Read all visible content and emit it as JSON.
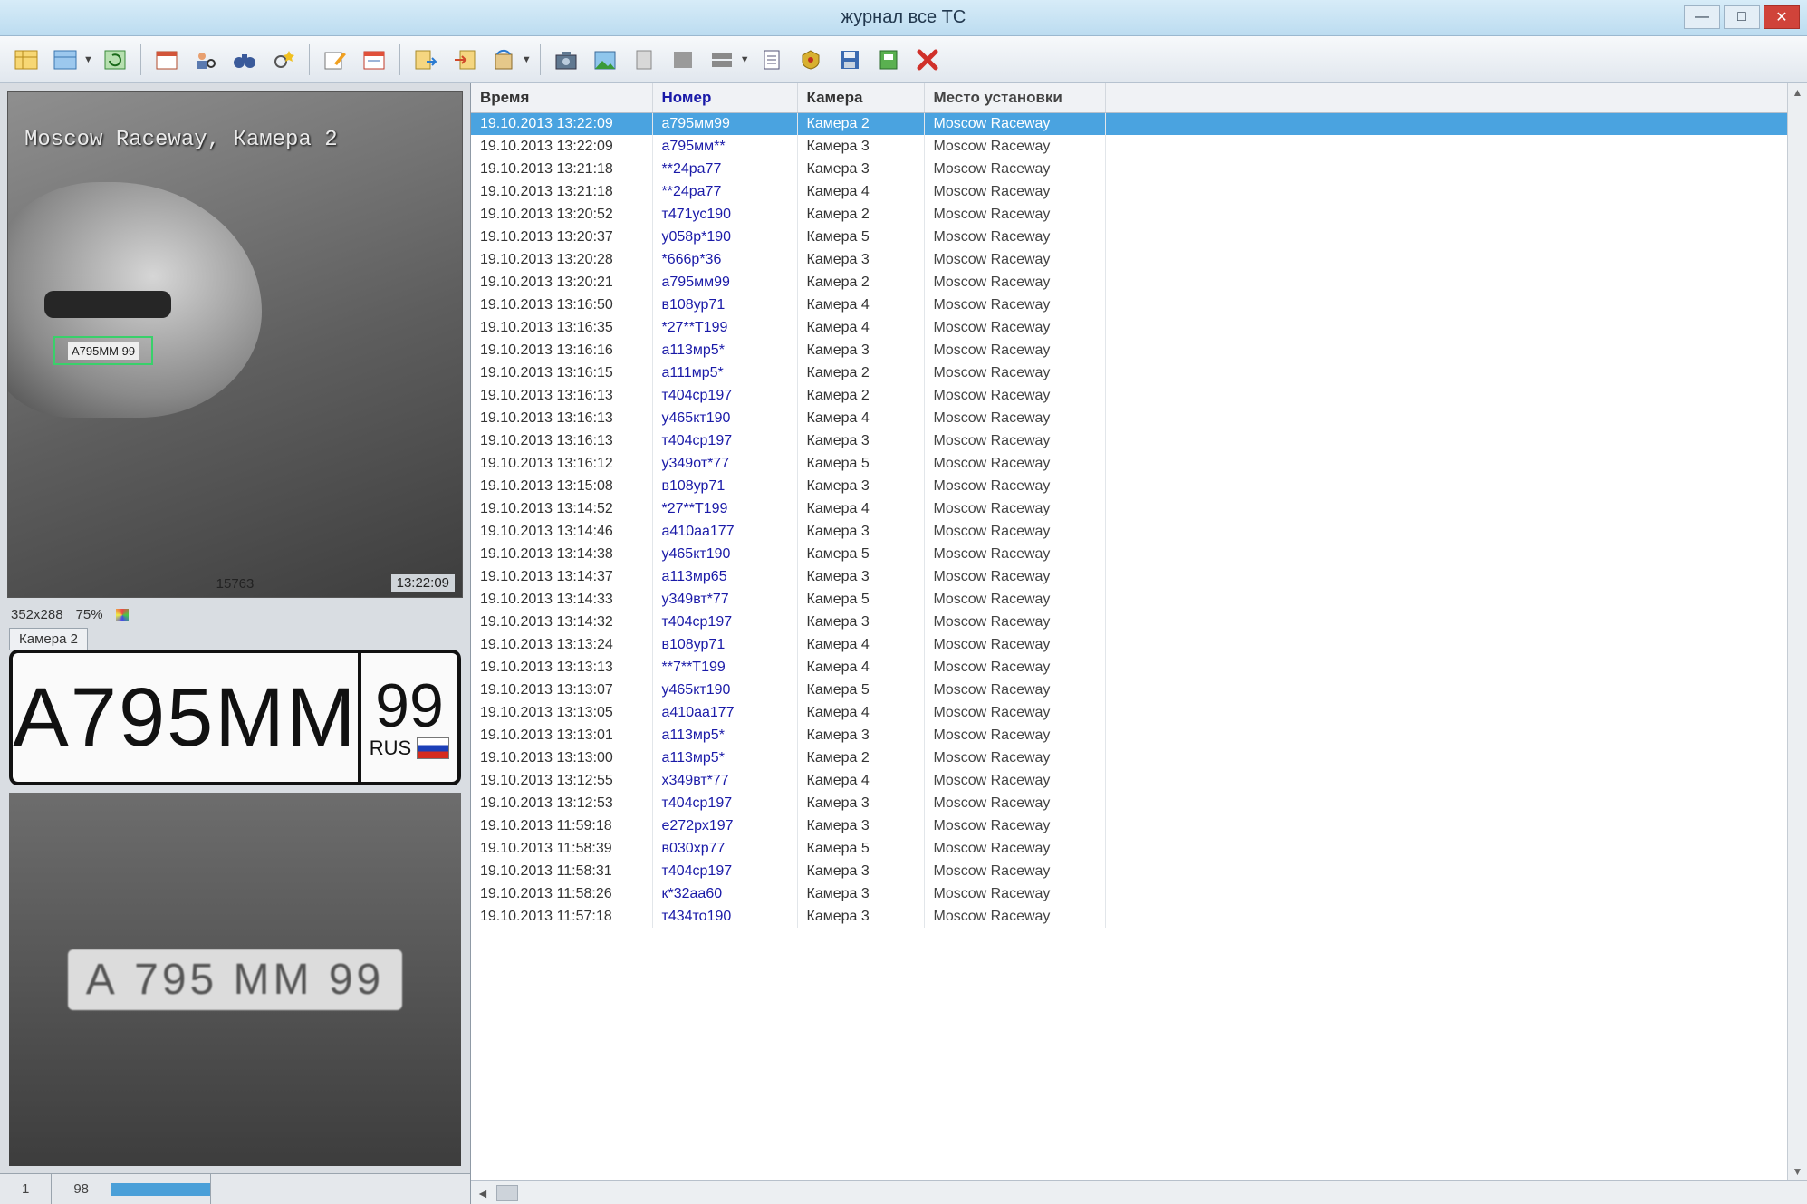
{
  "window": {
    "title": "журнал все ТС",
    "controls": [
      "—",
      "□",
      "✕"
    ]
  },
  "toolbar": {
    "icons": [
      "table-icon",
      "table-dropdown-icon",
      "refresh-icon",
      "calendar-icon",
      "search-person-icon",
      "binoculars-icon",
      "search-star-icon",
      "edit-icon",
      "form-icon",
      "export-icon",
      "import-icon",
      "sync-icon",
      "camera-icon",
      "image-icon",
      "document-icon",
      "grey-square-icon",
      "layout-icon",
      "list-icon",
      "emblem-icon",
      "save-icon",
      "book-icon",
      "close-icon"
    ]
  },
  "camera": {
    "overlay_text": "Moscow Raceway, Камера 2",
    "plate_box_text": "А795ММ 99",
    "frame_number": "15763",
    "timestamp": "13:22:09",
    "resolution": "352x288",
    "zoom": "75%",
    "tab_label": "Камера 2"
  },
  "plate": {
    "number": "А795ММ",
    "region": "99",
    "country": "RUS",
    "crop_text": "А 795 ММ 99"
  },
  "left_status": {
    "page": "1",
    "count": "98",
    "progress": 1.0
  },
  "table": {
    "columns": [
      "Время",
      "Номер",
      "Камера",
      "Место установки"
    ],
    "rows": [
      [
        "19.10.2013 13:22:09",
        "а795мм99",
        "Камера 2",
        "Moscow Raceway"
      ],
      [
        "19.10.2013 13:22:09",
        "а795мм**",
        "Камера 3",
        "Moscow Raceway"
      ],
      [
        "19.10.2013 13:21:18",
        "**24ра77",
        "Камера 3",
        "Moscow Raceway"
      ],
      [
        "19.10.2013 13:21:18",
        "**24ра77",
        "Камера 4",
        "Moscow Raceway"
      ],
      [
        "19.10.2013 13:20:52",
        "т471ус190",
        "Камера 2",
        "Moscow Raceway"
      ],
      [
        "19.10.2013 13:20:37",
        "у058р*190",
        "Камера 5",
        "Moscow Raceway"
      ],
      [
        "19.10.2013 13:20:28",
        "*666р*36",
        "Камера 3",
        "Moscow Raceway"
      ],
      [
        "19.10.2013 13:20:21",
        "а795мм99",
        "Камера 2",
        "Moscow Raceway"
      ],
      [
        "19.10.2013 13:16:50",
        "в108ур71",
        "Камера 4",
        "Moscow Raceway"
      ],
      [
        "19.10.2013 13:16:35",
        "*27**Т199",
        "Камера 4",
        "Moscow Raceway"
      ],
      [
        "19.10.2013 13:16:16",
        "а113мр5*",
        "Камера 3",
        "Moscow Raceway"
      ],
      [
        "19.10.2013 13:16:15",
        "а111мр5*",
        "Камера 2",
        "Moscow Raceway"
      ],
      [
        "19.10.2013 13:16:13",
        "т404ср197",
        "Камера 2",
        "Moscow Raceway"
      ],
      [
        "19.10.2013 13:16:13",
        "у465кт190",
        "Камера 4",
        "Moscow Raceway"
      ],
      [
        "19.10.2013 13:16:13",
        "т404ср197",
        "Камера 3",
        "Moscow Raceway"
      ],
      [
        "19.10.2013 13:16:12",
        "у349от*77",
        "Камера 5",
        "Moscow Raceway"
      ],
      [
        "19.10.2013 13:15:08",
        "в108ур71",
        "Камера 3",
        "Moscow Raceway"
      ],
      [
        "19.10.2013 13:14:52",
        "*27**Т199",
        "Камера 4",
        "Moscow Raceway"
      ],
      [
        "19.10.2013 13:14:46",
        "а410аа177",
        "Камера 3",
        "Moscow Raceway"
      ],
      [
        "19.10.2013 13:14:38",
        "у465кт190",
        "Камера 5",
        "Moscow Raceway"
      ],
      [
        "19.10.2013 13:14:37",
        "а113мр65",
        "Камера 3",
        "Moscow Raceway"
      ],
      [
        "19.10.2013 13:14:33",
        "у349вт*77",
        "Камера 5",
        "Moscow Raceway"
      ],
      [
        "19.10.2013 13:14:32",
        "т404ср197",
        "Камера 3",
        "Moscow Raceway"
      ],
      [
        "19.10.2013 13:13:24",
        "в108ур71",
        "Камера 4",
        "Moscow Raceway"
      ],
      [
        "19.10.2013 13:13:13",
        "**7**Т199",
        "Камера 4",
        "Moscow Raceway"
      ],
      [
        "19.10.2013 13:13:07",
        "у465кт190",
        "Камера 5",
        "Moscow Raceway"
      ],
      [
        "19.10.2013 13:13:05",
        "а410аа177",
        "Камера 4",
        "Moscow Raceway"
      ],
      [
        "19.10.2013 13:13:01",
        "а113мр5*",
        "Камера 3",
        "Moscow Raceway"
      ],
      [
        "19.10.2013 13:13:00",
        "а113мр5*",
        "Камера 2",
        "Moscow Raceway"
      ],
      [
        "19.10.2013 13:12:55",
        "х349вт*77",
        "Камера 4",
        "Moscow Raceway"
      ],
      [
        "19.10.2013 13:12:53",
        "т404ср197",
        "Камера 3",
        "Moscow Raceway"
      ],
      [
        "19.10.2013 11:59:18",
        "е272рх197",
        "Камера 3",
        "Moscow Raceway"
      ],
      [
        "19.10.2013 11:58:39",
        "в030хр77",
        "Камера 5",
        "Moscow Raceway"
      ],
      [
        "19.10.2013 11:58:31",
        "т404ср197",
        "Камера 3",
        "Moscow Raceway"
      ],
      [
        "19.10.2013 11:58:26",
        "к*32аа60",
        "Камера 3",
        "Moscow Raceway"
      ],
      [
        "19.10.2013 11:57:18",
        "т434то190",
        "Камера 3",
        "Moscow Raceway"
      ]
    ],
    "selected_row": 0
  },
  "colors": {
    "selection": "#4aa3e0",
    "plate_number_text": "#1a1aa8",
    "close_accent": "#d0433a"
  }
}
